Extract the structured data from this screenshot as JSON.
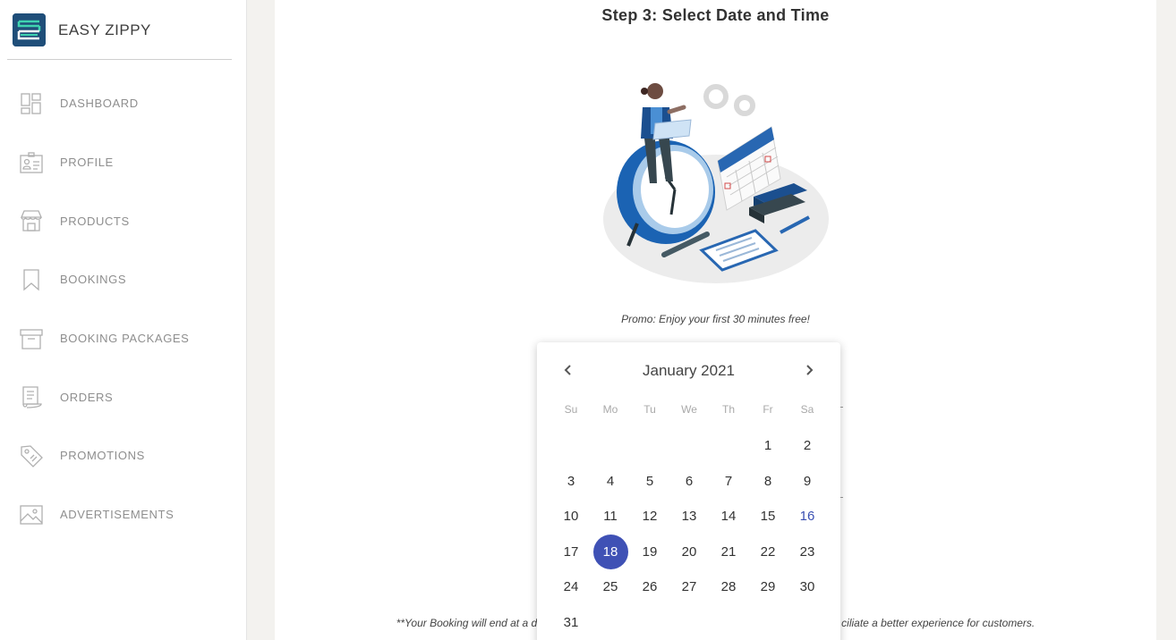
{
  "brand": {
    "name": "EASY ZIPPY"
  },
  "sidebar": {
    "items": [
      {
        "label": "DASHBOARD",
        "icon": "dashboard-icon"
      },
      {
        "label": "PROFILE",
        "icon": "id-card-icon"
      },
      {
        "label": "PRODUCTS",
        "icon": "storefront-icon"
      },
      {
        "label": "BOOKINGS",
        "icon": "bookmark-icon"
      },
      {
        "label": "BOOKING PACKAGES",
        "icon": "archive-box-icon"
      },
      {
        "label": "ORDERS",
        "icon": "receipt-icon"
      },
      {
        "label": "PROMOTIONS",
        "icon": "tag-icon"
      },
      {
        "label": "ADVERTISEMENTS",
        "icon": "image-icon"
      }
    ]
  },
  "main": {
    "step_title": "Step 3: Select Date and Time",
    "illustration": "scheduling-illustration",
    "promo": "Promo: Enjoy your first 30 minutes free!",
    "footnote_left": "**Your Booking will end at a d",
    "footnote_right": "ciliate a better experience for customers."
  },
  "calendar": {
    "month_label": "January 2021",
    "prev_icon": "chevron-left-icon",
    "next_icon": "chevron-right-icon",
    "weekdays": [
      "Su",
      "Mo",
      "Tu",
      "We",
      "Th",
      "Fr",
      "Sa"
    ],
    "leading_blanks": 5,
    "days": [
      "1",
      "2",
      "3",
      "4",
      "5",
      "6",
      "7",
      "8",
      "9",
      "10",
      "11",
      "12",
      "13",
      "14",
      "15",
      "16",
      "17",
      "18",
      "19",
      "20",
      "21",
      "22",
      "23",
      "24",
      "25",
      "26",
      "27",
      "28",
      "29",
      "30",
      "31"
    ],
    "selected_day": "18",
    "today_day": "16",
    "colors": {
      "selected_bg": "#3f51b5",
      "today_text": "#3a4fb2"
    }
  }
}
